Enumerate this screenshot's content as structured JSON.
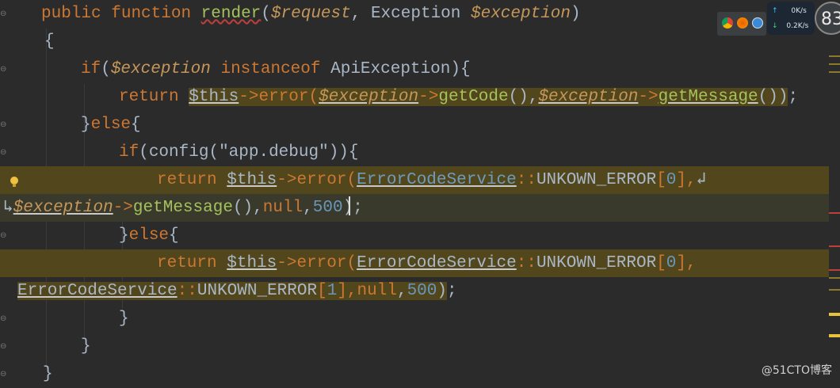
{
  "lines": {
    "l1": {
      "kw1": "public",
      "kw2": "function",
      "name": "render",
      "open": "(",
      "arg1": "$request",
      "comma": ",",
      "type": "Exception",
      "arg2": "$exception",
      "close": ")"
    },
    "l2": {
      "brace": "{"
    },
    "l3": {
      "kw": "if",
      "open": "(",
      "var": "$exception",
      "inst": "instanceof",
      "cls": "ApiException",
      "close": "){"
    },
    "l4": {
      "ret": "return",
      "this": "$this",
      "arrow1": "->",
      "m1": "error",
      "p1": "(",
      "v1": "$exception",
      "arrow2": "->",
      "m2": "getCode",
      "p2": "(),",
      "v2": "$exception",
      "arrow3": "->",
      "m3": "getMessage",
      "p3": "())",
      "semi": ";"
    },
    "l5": {
      "close": "}",
      "kw": "else",
      "open": "{"
    },
    "l6": {
      "kw": "if",
      "open": "(",
      "fn": "config",
      "p1": "(",
      "str": "\"app.debug\"",
      "close": "))",
      "brace": "{"
    },
    "l7": {
      "ret": "return",
      "this": "$this",
      "arrow": "->",
      "m": "error",
      "p": "(",
      "cls": "ErrorCodeService",
      "dc": "::",
      "const": "UNKOWN_ERROR",
      "b1": "[",
      "idx": "0",
      "b2": "],",
      "wrap": "↲"
    },
    "l8": {
      "wrap": "↳",
      "var": "$exception",
      "arrow": "->",
      "m": "getMessage",
      "p": "(),",
      "nul": "null",
      "c": ",",
      "num": "500",
      "close": ")",
      "semi": ";"
    },
    "l9": {
      "close": "}",
      "kw": "else",
      "open": "{"
    },
    "l10": {
      "ret": "return",
      "this": "$this",
      "arrow": "->",
      "m": "error",
      "p": "(",
      "cls": "ErrorCodeService",
      "dc": "::",
      "const": "UNKOWN_ERROR",
      "b1": "[",
      "idx": "0",
      "b2": "],"
    },
    "l11": {
      "cls": "ErrorCodeService",
      "dc": "::",
      "const": "UNKOWN_ERROR",
      "b1": "[",
      "idx": "1",
      "b2": "],",
      "nul": "null",
      "c": ",",
      "num": "500",
      "close": ")",
      "semi": ";"
    },
    "l12": {
      "brace": "}"
    },
    "l13": {
      "brace": "}"
    },
    "l14": {
      "brace": "}"
    }
  },
  "net": {
    "up": "0K/s",
    "down": "0.2K/s",
    "up_arrow": "↑",
    "down_arrow": "↓",
    "percent": "83"
  },
  "watermark": "@51CTO博客",
  "colors": {
    "background": "#2b2b2b",
    "keyword": "#cc7832",
    "function": "#a5c25c",
    "variable": "#9876aa",
    "highlight": "#52461c"
  }
}
